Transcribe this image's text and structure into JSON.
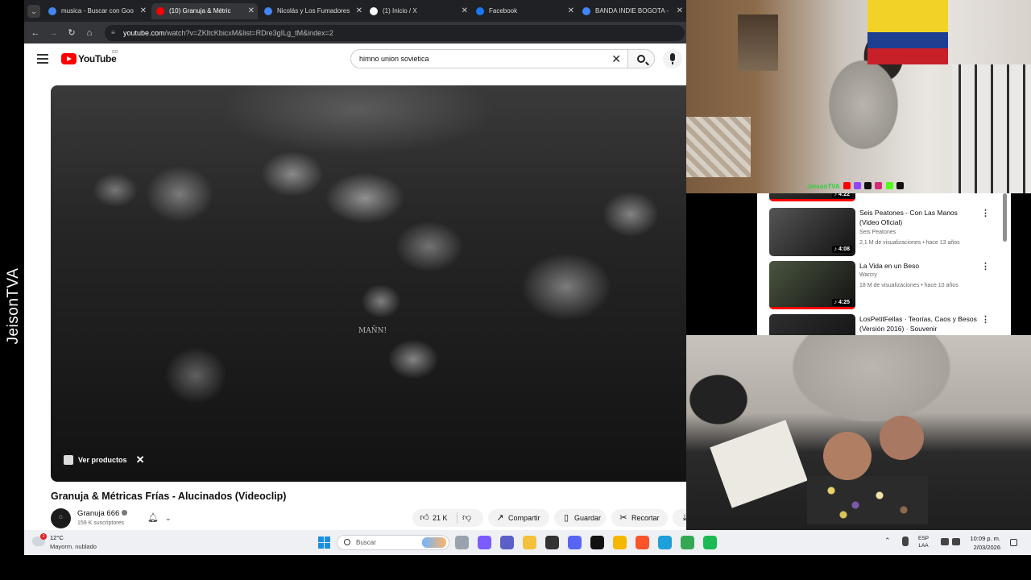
{
  "stream_watermark": "JeisonTVA",
  "browser": {
    "tabs": [
      {
        "label": "musica - Buscar con Goo",
        "favicon_color": "#4285f4",
        "active": false
      },
      {
        "label": "(10) Granuja & Métric",
        "favicon_color": "#ff0000",
        "active": true
      },
      {
        "label": "Nicolás y Los Fumadores",
        "favicon_color": "#4285f4",
        "active": false
      },
      {
        "label": "(1) Inicio / X",
        "favicon_color": "#ffffff",
        "active": false
      },
      {
        "label": "Facebook",
        "favicon_color": "#1877f2",
        "active": false
      },
      {
        "label": "BANDA INDIE BOGOTA -",
        "favicon_color": "#4285f4",
        "active": false
      }
    ],
    "url_host": "youtube.com",
    "url_rest": "/watch?v=ZKltcKbicxM&list=RDre3gILg_tM&index=2"
  },
  "youtube": {
    "logo_text": "YouTube",
    "country_code": "CO",
    "search_value": "himno union sovietica",
    "video": {
      "overlay_text": "MAÑN!",
      "products_chip": "Ver productos",
      "title": "Granuja & Métricas Frías - Alucinados (Videoclip)",
      "channel": "Granuja 666",
      "channel_initials": "G",
      "subscribers": "159 K suscriptores",
      "likes": "21 K",
      "share_label": "Compartir",
      "save_label": "Guardar",
      "clip_label": "Recortar"
    },
    "related": [
      {
        "title": "",
        "channel": "",
        "meta": "",
        "duration": "4:22",
        "thumb_color": "#3a3a3a",
        "progress": 1.0
      },
      {
        "title": "Seis Peatones - Con Las Manos (Video Oficial)",
        "channel": "Seis Peatones",
        "meta": "2,1 M de visualizaciones • hace 13 años",
        "duration": "4:08",
        "thumb_color": "#555555",
        "progress": 0
      },
      {
        "title": "La Vida en un Beso",
        "channel": "Warcry",
        "meta": "18 M de visualizaciones • hace 10 años",
        "duration": "4:25",
        "thumb_color": "#4a5540",
        "progress": 1.0
      },
      {
        "title": "LosPetitFellas · Teorías, Caos y Besos (Versión 2016) · Souvenir",
        "channel": "",
        "meta": "",
        "duration": "",
        "thumb_color": "#2e2e2e",
        "progress": 0
      }
    ]
  },
  "webcam": {
    "social_handle": "JeisonTVA"
  },
  "taskbar": {
    "temperature": "12°C",
    "condition": "Mayorm. nublado",
    "weather_badge": "2",
    "search_label": "Buscar",
    "language_line1": "ESP",
    "language_line2": "LAA",
    "time": "10:09 p. m.",
    "date": "2/03/2026",
    "apps": [
      {
        "icon": "task-view-icon",
        "color": "#9aa3ad"
      },
      {
        "icon": "copilot-icon",
        "color": "#7a5cff"
      },
      {
        "icon": "teams-icon",
        "color": "#5b5fc7"
      },
      {
        "icon": "file-explorer-icon",
        "color": "#f3c13a"
      },
      {
        "icon": "game-icon",
        "color": "#333333"
      },
      {
        "icon": "discord-icon",
        "color": "#5865f2"
      },
      {
        "icon": "tiktok-icon",
        "color": "#111111"
      },
      {
        "icon": "app-icon",
        "color": "#f5b800"
      },
      {
        "icon": "brave-icon",
        "color": "#fb542b"
      },
      {
        "icon": "edge-icon",
        "color": "#1f9fd8"
      },
      {
        "icon": "chrome-icon",
        "color": "#34a853"
      },
      {
        "icon": "spotify-icon",
        "color": "#1db954"
      }
    ]
  }
}
